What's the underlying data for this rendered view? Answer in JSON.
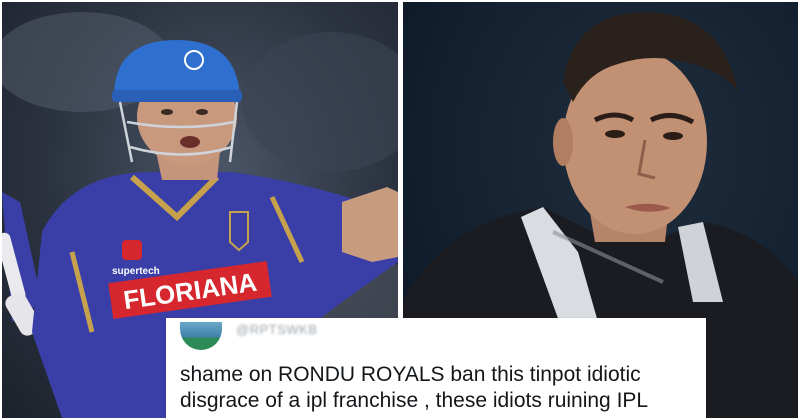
{
  "left_photo": {
    "description_icon": "cricketer-photo",
    "jersey_sponsor": "FLORIANA",
    "chest_logo": "supertech",
    "helmet_color": "#2f6fd0",
    "jersey_color": "#3a3fa8",
    "sponsor_band_color": "#d6262e"
  },
  "right_photo": {
    "description_icon": "cricketer-portrait",
    "shirt_color": "#1a1c22",
    "collar_color": "#d9dde2"
  },
  "tweet": {
    "lines": [
      "shame on RONDU ROYALS ban this tinpot idiotic",
      "disgrace of a ipl franchise , these idiots ruining IPL"
    ],
    "background": "#ffffff",
    "text_color": "#14171a"
  }
}
